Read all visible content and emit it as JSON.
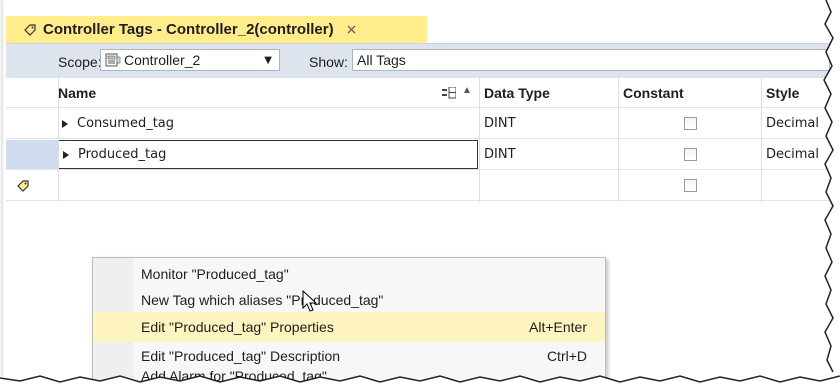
{
  "tab": {
    "title": "Controller Tags - Controller_2(controller)",
    "close_glyph": "×",
    "icon": "tag-icon"
  },
  "scope_bar": {
    "scope_label": "Scope:",
    "scope_value": "Controller_2",
    "scope_icon": "controller-icon",
    "show_label": "Show:",
    "show_value": "All Tags"
  },
  "grid": {
    "columns": [
      "Name",
      "Data Type",
      "Constant",
      "Style"
    ],
    "sort_glyph": "▲",
    "rows": [
      {
        "name": "Consumed_tag",
        "data_type": "DINT",
        "style": "Decimal",
        "constant_checked": false
      },
      {
        "name": "Produced_tag",
        "data_type": "DINT",
        "style": "Decimal",
        "constant_checked": false
      },
      {
        "name": "",
        "data_type": "",
        "style": "",
        "constant_checked": false
      }
    ]
  },
  "context_menu": {
    "items": [
      {
        "label": "Monitor \"Produced_tag\"",
        "shortcut": ""
      },
      {
        "label": "New Tag which aliases \"Produced_tag\"",
        "shortcut": ""
      },
      {
        "label": "Edit \"Produced_tag\" Properties",
        "shortcut": "Alt+Enter",
        "highlighted": true
      },
      {
        "label": "Edit \"Produced_tag\" Description",
        "shortcut": "Ctrl+D"
      },
      {
        "label": "Add Alarm for \"Produced_tag\"",
        "shortcut": ""
      }
    ]
  },
  "colors": {
    "tab_active": "#ffec8b",
    "toolbar": "#dde4ee",
    "menu_highlight": "#fdf4bf",
    "selection": "#cfdcf0"
  }
}
